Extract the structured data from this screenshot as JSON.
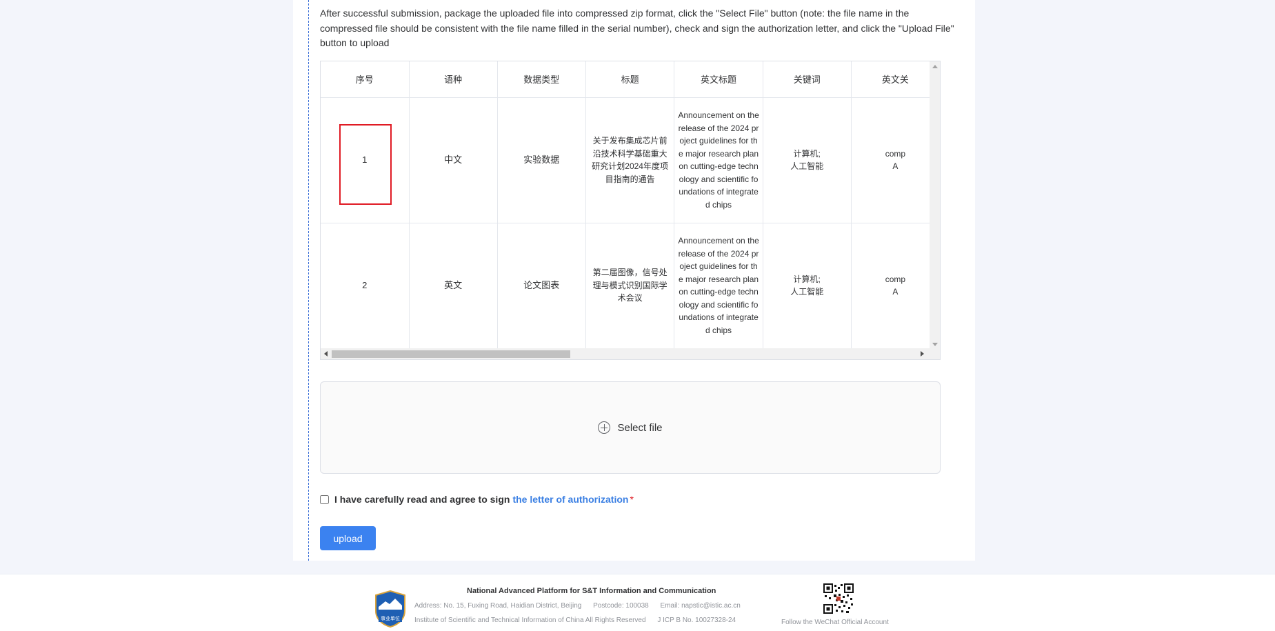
{
  "instructions": "After successful submission, package the uploaded file into compressed zip format, click the \"Select File\" button (note: the file name in the compressed file should be consistent with the file name filled in the serial number), check and sign the authorization letter, and click the \"Upload File\" button to upload",
  "table": {
    "headers": [
      "序号",
      "语种",
      "数据类型",
      "标题",
      "英文标题",
      "关键词",
      "英文关"
    ],
    "rows": [
      {
        "num": "1",
        "lang": "中文",
        "dtype": "实验数据",
        "title": "关于发布集成芯片前沿技术科学基础重大研究计划2024年度项目指南的通告",
        "en_title": "Announcement on the release of the 2024 project guidelines for the major research plan on cutting-edge technology and scientific foundations of integrated chips",
        "keywords_1": "计算机;",
        "keywords_2": "人工智能",
        "en_kw_1": "comp",
        "en_kw_2": "A"
      },
      {
        "num": "2",
        "lang": "英文",
        "dtype": "论文图表",
        "title": "第二届图像，信号处理与模式识别国际学术会议",
        "en_title": "Announcement on the release of the 2024 project guidelines for the major research plan on cutting-edge technology and scientific foundations of integrated chips",
        "keywords_1": "计算机;",
        "keywords_2": "人工智能",
        "en_kw_1": "comp",
        "en_kw_2": "A"
      }
    ]
  },
  "upload_area": {
    "label": "Select file",
    "icon": "plus-circle-icon"
  },
  "agreement": {
    "text": "I have carefully read and agree to sign",
    "link": "the letter of authorization",
    "required_mark": "*",
    "checked": false
  },
  "upload_button": "upload",
  "footer": {
    "title": "National Advanced Platform for S&T Information and Communication",
    "address": "Address: No. 15, Fuxing Road, Haidian District, Beijing",
    "postcode": "Postcode: 100038",
    "email": "Email: napstic@istic.ac.cn",
    "copyright": "Institute of Scientific and Technical Information of China All Rights Reserved",
    "icp": "J ICP B No. 10027328-24",
    "logo_text": "事业单位",
    "qr_caption": "Follow the WeChat Official Account"
  },
  "colors": {
    "primary": "#3b82f0",
    "link": "#3a7fe3",
    "highlight": "#e01b24",
    "background": "#f3f5fb"
  }
}
